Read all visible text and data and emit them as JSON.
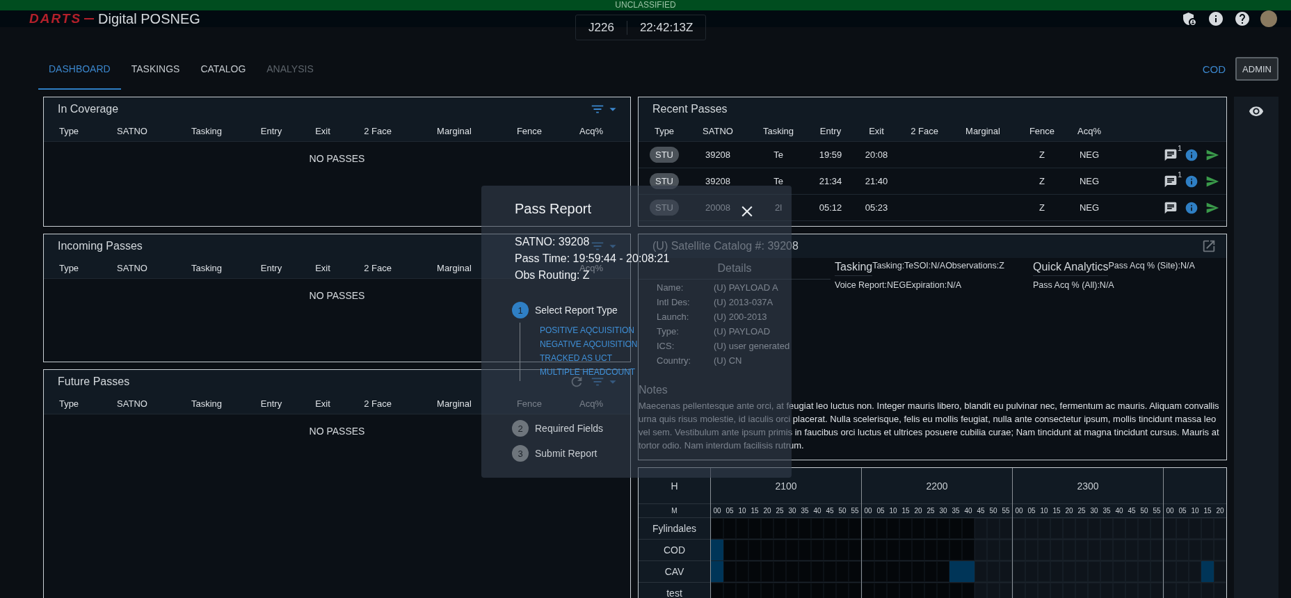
{
  "banner": {
    "text": "UNCLASSIFIED"
  },
  "header": {
    "logo": "DARTS",
    "title": "Digital POSNEG",
    "julian": "J226",
    "clock": "22:42:13Z"
  },
  "tabs": [
    {
      "label": "DASHBOARD",
      "selected": true,
      "disabled": false
    },
    {
      "label": "TASKINGS",
      "selected": false,
      "disabled": false
    },
    {
      "label": "CATALOG",
      "selected": false,
      "disabled": false
    },
    {
      "label": "ANALYSIS",
      "selected": false,
      "disabled": true
    }
  ],
  "site_link": "COD",
  "admin_button": "ADMIN",
  "pass_panels": [
    {
      "kind": "coverage",
      "title": "In Coverage",
      "columns": [
        "Type",
        "SATNO",
        "Tasking",
        "Entry",
        "Exit",
        "2 Face",
        "Marginal",
        "Fence",
        "Acq%"
      ],
      "empty_text": "NO PASSES"
    },
    {
      "kind": "incoming",
      "title": "Incoming Passes",
      "columns": [
        "Type",
        "SATNO",
        "Tasking",
        "Entry",
        "Exit",
        "2 Face",
        "Marginal",
        "Acq%"
      ],
      "empty_text": "NO PASSES"
    },
    {
      "kind": "future",
      "title": "Future Passes",
      "columns": [
        "Type",
        "SATNO",
        "Tasking",
        "Entry",
        "Exit",
        "2 Face",
        "Marginal",
        "Fence",
        "Acq%"
      ],
      "empty_text": "NO PASSES"
    }
  ],
  "recent_passes": {
    "title": "Recent Passes",
    "columns": [
      "Type",
      "SATNO",
      "Tasking",
      "Entry",
      "Exit",
      "2 Face",
      "Marginal",
      "Fence",
      "Acq%"
    ],
    "rows": [
      {
        "type": "STU",
        "satno": "39208",
        "tasking": "Te",
        "entry": "19:59",
        "exit": "20:08",
        "fence": "Z",
        "acq": "NEG",
        "comment_count": "1"
      },
      {
        "type": "STU",
        "satno": "39208",
        "tasking": "Te",
        "entry": "21:34",
        "exit": "21:40",
        "fence": "Z",
        "acq": "NEG",
        "comment_count": "1"
      },
      {
        "type": "STU",
        "satno": "20008",
        "tasking": "2l",
        "entry": "05:12",
        "exit": "05:23",
        "fence": "Z",
        "acq": "NEG"
      }
    ]
  },
  "catalog": {
    "title": "(U) Satellite Catalog #: 39208",
    "details_heading": "Details",
    "details": [
      {
        "label": "Name:",
        "value": "(U) PAYLOAD A"
      },
      {
        "label": "Intl Des:",
        "value": "(U) 2013-037A"
      },
      {
        "label": "Launch:",
        "value": "(U) 200-2013"
      },
      {
        "label": "Type:",
        "value": "(U) PAYLOAD"
      },
      {
        "label": "ICS:",
        "value": "(U) user generated"
      },
      {
        "label": "Country:",
        "value": "(U) CN"
      }
    ],
    "tasking": {
      "heading": "Tasking",
      "line1": "Tasking:TeSOI:N/AObservations:Z",
      "line2": "Voice Report:NEGExpiration:N/A"
    },
    "analytics": {
      "heading": "Quick Analytics",
      "line1": "Pass Acq % (Site):N/A",
      "line2": "Pass Acq % (All):N/A"
    },
    "notes_heading": "Notes",
    "notes": "Maecenas pellentesque ante orci, at feugiat leo luctus non. Integer mauris libero, blandit eu pulvinar nec, fermentum ac mauris. Aliquam convallis urna quis risus molestie, id iaculis orci placerat. Nulla scelerisque, felis eu mollis feugiat, nulla ante consectetur ipsum, mollis tincidunt massa leo vel sem. Vestibulum ante ipsum primis in faucibus orci luctus et ultrices posuere cubilia curae; Nam tincidunt at magna tincidunt cursus. Mauris at tortor odio. Nam interdum facilisis rutrum."
  },
  "timeline": {
    "hour_label": "H",
    "minute_label": "M",
    "hours": [
      {
        "label": "2100",
        "minutes": [
          "00",
          "05",
          "10",
          "15",
          "20",
          "25",
          "30",
          "35",
          "40",
          "45",
          "50",
          "55"
        ]
      },
      {
        "label": "2200",
        "minutes": [
          "00",
          "05",
          "10",
          "15",
          "20",
          "25",
          "30",
          "35",
          "40",
          "45",
          "50",
          "55"
        ]
      },
      {
        "label": "2300",
        "minutes": [
          "00",
          "05",
          "10",
          "15",
          "20",
          "25",
          "30",
          "35",
          "40",
          "45",
          "50",
          "55"
        ]
      },
      {
        "minutes": [
          "00",
          "05",
          "10",
          "15",
          "20"
        ]
      }
    ],
    "sites": [
      {
        "name": "Fylindales",
        "filled": [
          [
            false,
            false,
            false,
            false,
            false,
            false,
            false,
            false,
            false,
            false,
            false,
            false
          ],
          [
            false,
            false,
            false,
            false,
            false,
            false,
            false,
            false,
            false,
            false,
            false,
            false
          ],
          [
            false,
            false,
            false,
            false,
            false,
            false,
            false,
            false,
            false,
            false,
            false,
            false
          ],
          [
            false,
            false,
            false,
            false,
            false
          ]
        ]
      },
      {
        "name": "COD",
        "filled": [
          [
            true,
            false,
            false,
            false,
            false,
            false,
            false,
            false,
            false,
            false,
            false,
            false
          ],
          [
            false,
            false,
            false,
            false,
            false,
            false,
            false,
            false,
            false,
            false,
            false,
            false
          ],
          [
            false,
            false,
            false,
            false,
            false,
            false,
            false,
            false,
            false,
            false,
            false,
            false
          ],
          [
            false,
            false,
            false,
            false,
            false
          ]
        ]
      },
      {
        "name": "CAV",
        "filled": [
          [
            true,
            false,
            false,
            false,
            false,
            false,
            false,
            false,
            false,
            false,
            false,
            false
          ],
          [
            false,
            false,
            false,
            false,
            false,
            false,
            false,
            true,
            true,
            false,
            false,
            false
          ],
          [
            false,
            false,
            false,
            false,
            false,
            false,
            false,
            false,
            false,
            false,
            false,
            false
          ],
          [
            false,
            false,
            false,
            true,
            false
          ]
        ]
      },
      {
        "name": "test",
        "filled": [
          [
            false,
            false,
            false,
            false,
            false,
            false,
            false,
            false,
            false,
            false,
            false,
            false
          ],
          [
            false,
            false,
            false,
            false,
            false,
            false,
            false,
            false,
            false,
            false,
            false,
            false
          ],
          [
            false,
            false,
            false,
            false,
            false,
            false,
            false,
            false,
            false,
            false,
            false,
            false
          ],
          [
            false,
            false,
            false,
            false,
            false
          ]
        ]
      }
    ]
  },
  "pass_report": {
    "title": "Pass Report",
    "lines": [
      "SATNO: 39208",
      "Pass Time: 19:59:44 - 20:08:21",
      "Obs Routing: Z"
    ],
    "steps": [
      {
        "number": "1",
        "label": "Select Report Type",
        "active": true,
        "options": [
          "POSITIVE AQCUISITION",
          "NEGATIVE AQCUISITION",
          "TRACKED AS UCT",
          "MULTIPLE HEADCOUNT"
        ]
      },
      {
        "number": "2",
        "label": "Required Fields",
        "active": false
      },
      {
        "number": "3",
        "label": "Submit Report",
        "active": false
      }
    ]
  }
}
